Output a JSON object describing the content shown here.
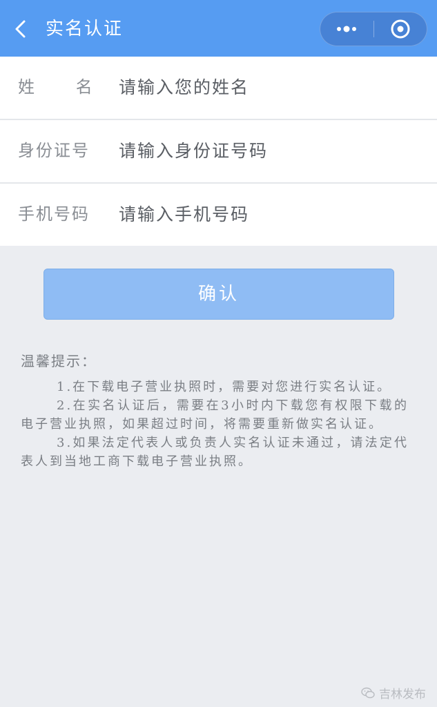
{
  "nav": {
    "title": "实名认证",
    "back_icon": "chevron-left-icon",
    "more_icon": "more-dots-icon",
    "close_icon": "target-circle-icon",
    "bg_color": "#569cf2"
  },
  "form": {
    "name": {
      "label": "姓      名",
      "placeholder": "请输入您的姓名",
      "value": ""
    },
    "id_number": {
      "label": "身份证号",
      "placeholder": "请输入身份证号码",
      "value": ""
    },
    "phone": {
      "label": "手机号码",
      "placeholder": "请输入手机号码",
      "value": ""
    }
  },
  "confirm": {
    "label": "确认",
    "color": "#8fbcf4",
    "enabled": false
  },
  "tips": {
    "title": "温馨提示：",
    "items": [
      "1.在下载电子营业执照时，需要对您进行实名认证。",
      "2.在实名认证后，需要在3小时内下载您有权限下载的电子营业执照，如果超过时间，将需要重新做实名认证。",
      "3.如果法定代表人或负责人实名认证未通过，请法定代表人到当地工商下载电子营业执照。"
    ]
  },
  "watermark": {
    "text": "吉林发布",
    "icon": "wechat-icon"
  }
}
